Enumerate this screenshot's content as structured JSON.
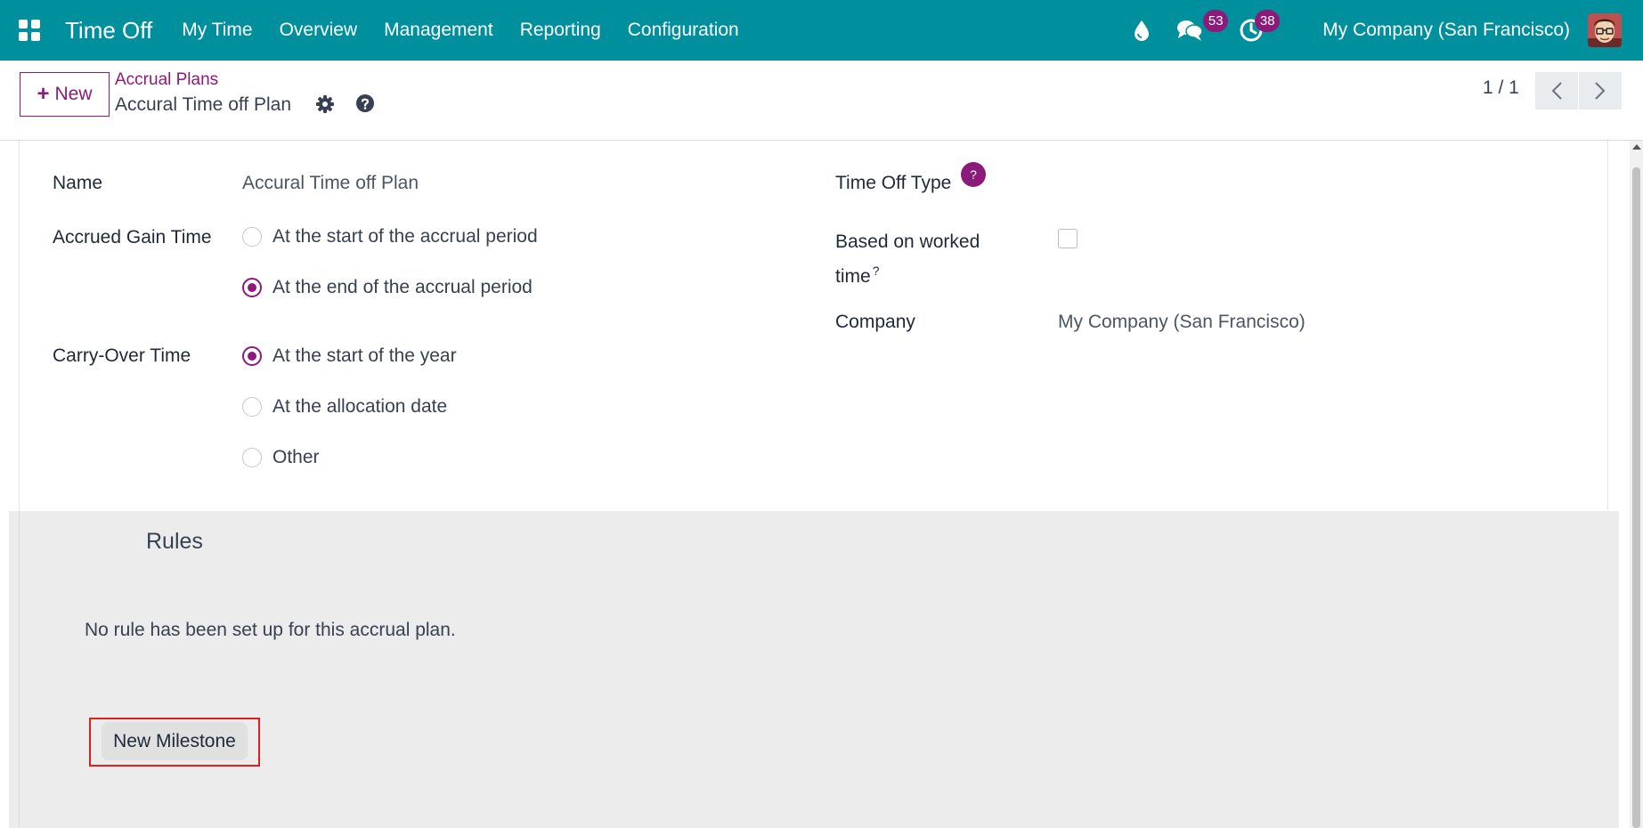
{
  "navbar": {
    "app_title": "Time Off",
    "menu": [
      "My Time",
      "Overview",
      "Management",
      "Reporting",
      "Configuration"
    ],
    "messages_count": "53",
    "activities_count": "38",
    "company": "My Company (San Francisco)",
    "icons": [
      "apps-grid-icon",
      "drop-icon",
      "chat-icon",
      "clock-icon",
      "avatar"
    ]
  },
  "control_panel": {
    "new_label": "New",
    "breadcrumb": "Accrual Plans",
    "record_title": "Accural Time off Plan",
    "pager": "1 / 1"
  },
  "form": {
    "name_label": "Name",
    "name_value": "Accural Time off Plan",
    "accrued_gain_label": "Accrued Gain Time",
    "accrued_gain_options": [
      {
        "label": "At the start of the accrual period",
        "checked": false
      },
      {
        "label": "At the end of the accrual period",
        "checked": true
      }
    ],
    "carry_over_label": "Carry-Over Time",
    "carry_over_options": [
      {
        "label": "At the start of the year",
        "checked": true
      },
      {
        "label": "At the allocation date",
        "checked": false
      },
      {
        "label": "Other",
        "checked": false
      }
    ],
    "time_off_type_label": "Time Off Type",
    "time_off_type_tooltip": "?",
    "based_on_worked_label_line1": "Based on worked",
    "based_on_worked_label_line2": "time",
    "based_on_worked_sup": "?",
    "based_on_worked_checked": false,
    "company_label": "Company",
    "company_value": "My Company (San Francisco)"
  },
  "rules": {
    "title": "Rules",
    "empty_message": "No rule has been set up for this accrual plan.",
    "new_milestone_label": "New Milestone"
  },
  "colors": {
    "navbar_bg": "#008f9c",
    "brand": "#8b1a7a",
    "highlight": "#e11d1d"
  }
}
